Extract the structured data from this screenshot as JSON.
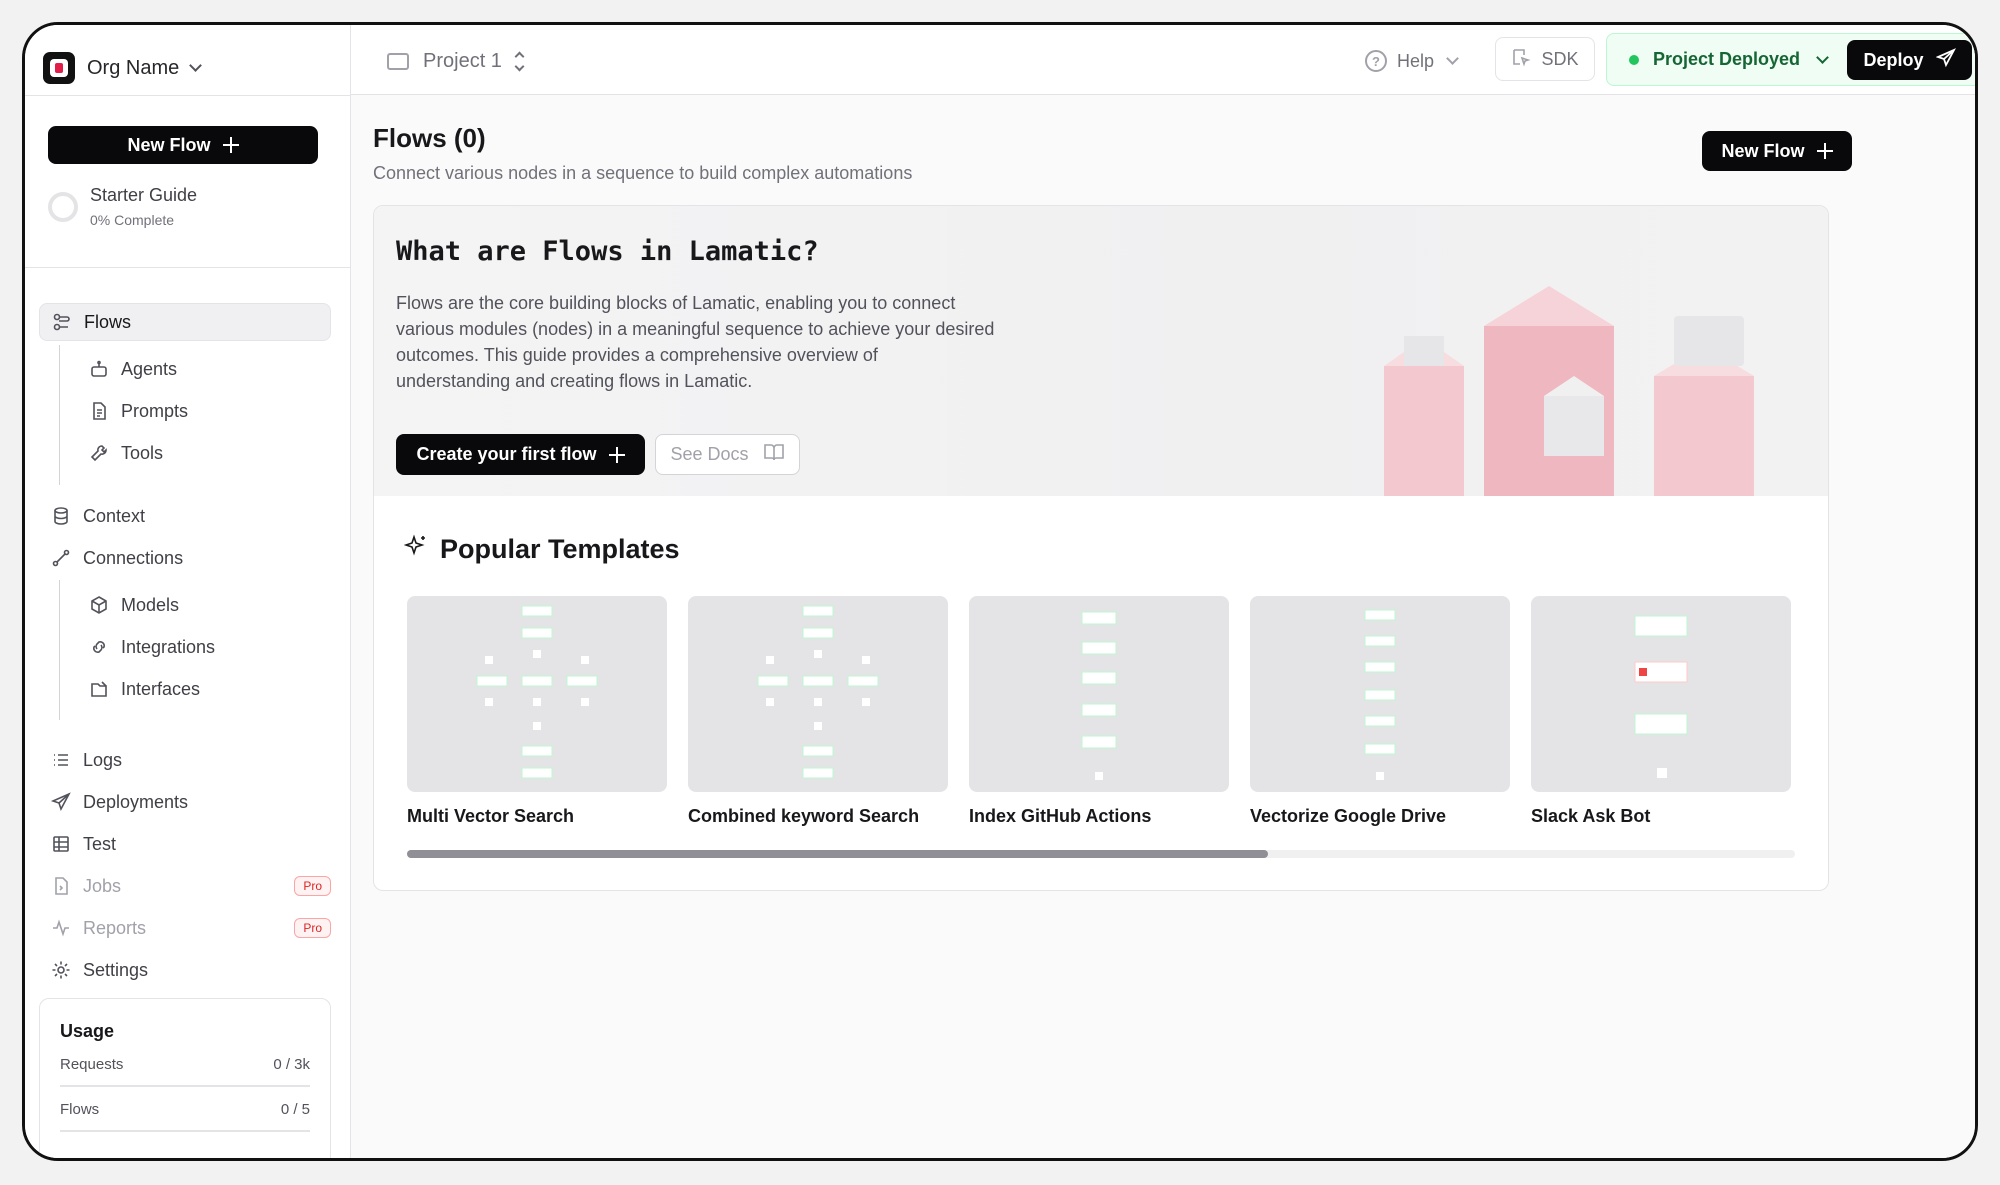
{
  "org": {
    "name": "Org Name"
  },
  "project": {
    "name": "Project 1"
  },
  "topbar": {
    "help_label": "Help",
    "sdk_label": "SDK",
    "deploy_status": "Project Deployed",
    "deploy_label": "Deploy",
    "status_color": "#22c55e"
  },
  "sidebar": {
    "new_flow_label": "New Flow",
    "starter": {
      "title": "Starter Guide",
      "progress_label": "0% Complete",
      "progress": 0
    },
    "items": [
      {
        "label": "Flows",
        "icon": "flows-icon",
        "active": true
      },
      {
        "label": "Agents",
        "icon": "bot-icon"
      },
      {
        "label": "Prompts",
        "icon": "file-text-icon"
      },
      {
        "label": "Tools",
        "icon": "wrench-icon"
      },
      {
        "label": "Context",
        "icon": "database-icon"
      },
      {
        "label": "Connections",
        "icon": "connection-icon"
      },
      {
        "label": "Models",
        "icon": "cube-icon"
      },
      {
        "label": "Integrations",
        "icon": "link-icon"
      },
      {
        "label": "Interfaces",
        "icon": "interface-icon"
      },
      {
        "label": "Logs",
        "icon": "list-icon"
      },
      {
        "label": "Deployments",
        "icon": "send-icon"
      },
      {
        "label": "Test",
        "icon": "table-icon"
      },
      {
        "label": "Jobs",
        "icon": "jobs-icon",
        "badge": "Pro",
        "disabled": true
      },
      {
        "label": "Reports",
        "icon": "activity-icon",
        "badge": "Pro",
        "disabled": true
      },
      {
        "label": "Settings",
        "icon": "gear-icon"
      }
    ],
    "usage": {
      "title": "Usage",
      "rows": [
        {
          "label": "Requests",
          "value": "0 / 3k"
        },
        {
          "label": "Flows",
          "value": "0 / 5"
        }
      ]
    }
  },
  "main": {
    "title": "Flows (0)",
    "subtitle": "Connect various nodes in a sequence to build complex automations",
    "new_flow_label": "New Flow",
    "hero": {
      "title": "What are Flows in Lamatic?",
      "description": "Flows are the core building blocks of Lamatic, enabling you to connect various modules (nodes) in a meaningful sequence to achieve your desired outcomes. This guide provides a comprehensive overview of understanding and creating flows in Lamatic.",
      "cta_label": "Create your first flow",
      "docs_label": "See Docs"
    },
    "templates": {
      "title": "Popular Templates",
      "items": [
        {
          "name": "Multi Vector Search"
        },
        {
          "name": "Combined keyword Search"
        },
        {
          "name": "Index GitHub Actions"
        },
        {
          "name": "Vectorize Google Drive"
        },
        {
          "name": "Slack Ask Bot"
        }
      ],
      "scroll_fraction": 0.62
    }
  }
}
